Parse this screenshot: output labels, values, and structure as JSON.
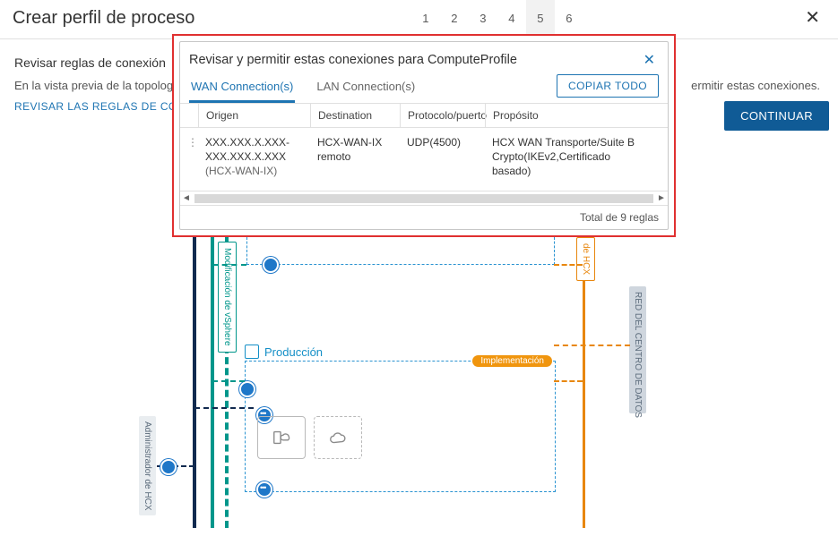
{
  "wizard": {
    "title": "Crear perfil de proceso",
    "steps": [
      "1",
      "2",
      "3",
      "4",
      "5",
      "6"
    ],
    "active_step_index": 4,
    "close_glyph": "✕"
  },
  "page": {
    "subtitle": "Revisar reglas de conexión",
    "description_prefix": "En la vista previa de la topología",
    "description_suffix": "ermitir estas conexiones.",
    "review_link": "REVISAR LAS REGLAS DE CONE",
    "continue_btn": "CONTINUAR"
  },
  "modal": {
    "title": "Revisar y permitir estas conexiones para ComputeProfile",
    "close_glyph": "✕",
    "tabs": {
      "wan": "WAN Connection(s)",
      "lan": "LAN Connection(s)"
    },
    "copy_all": "COPIAR TODO",
    "columns": {
      "c0": "",
      "c1": "Origen",
      "c2": "Destination",
      "c3": "Protocolo/puerto",
      "c4": "Propósito"
    },
    "rows": [
      {
        "origen_line1": "XXX.XXX.X.XXX-",
        "origen_line2": "XXX.XXX.X.XXX",
        "origen_sub": "(HCX-WAN-IX)",
        "destination": "HCX-WAN-IX remoto",
        "protocol": "UDP(4500)",
        "purpose": "HCX WAN Transporte/Suite B Crypto(IKEv2,Certificado basado)"
      }
    ],
    "footer": "Total de 9 reglas"
  },
  "topology": {
    "production_label": "Producción",
    "implementation_badge": "Implementación",
    "admin_label": "Administrador de HCX",
    "vsphere_label": "Modificación de vSphere",
    "hcx_rail_label": "de HCX",
    "dc_label": "RED DEL CENTRO DE DATOS"
  }
}
